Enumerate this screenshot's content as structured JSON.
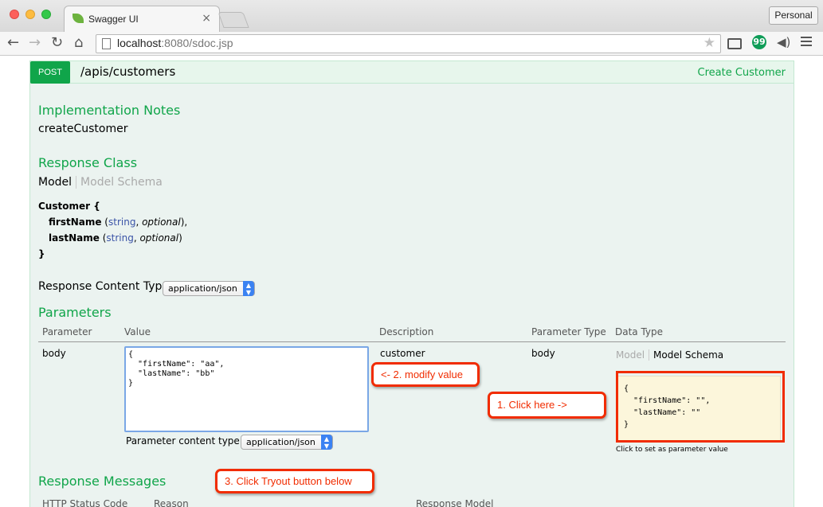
{
  "browser": {
    "tab_title": "Swagger UI",
    "tab_close": "×",
    "profile_label": "Personal",
    "url_host": "localhost",
    "url_rest": ":8080/sdoc.jsp",
    "icons": [
      "back-arrow-icon",
      "forward-arrow-icon",
      "reload-icon",
      "home-icon",
      "star-icon",
      "cast-icon",
      "hangouts-icon",
      "audio-icon",
      "menu-icon"
    ],
    "hangouts_glyph": "99"
  },
  "operation": {
    "method": "POST",
    "path": "/apis/customers",
    "summary": "Create Customer",
    "method_color": "#10a54a"
  },
  "implementation": {
    "heading": "Implementation Notes",
    "text": "createCustomer"
  },
  "response_class": {
    "heading": "Response Class",
    "tab_model": "Model",
    "tab_schema": "Model Schema",
    "model_name": "Customer {",
    "props": [
      {
        "name": "firstName",
        "type": "string",
        "opt": "optional",
        "end": "),"
      },
      {
        "name": "lastName",
        "type": "string",
        "opt": "optional",
        "end": ")"
      }
    ],
    "close": "}"
  },
  "response_content_type": {
    "label": "Response Content Type",
    "value": "application/json"
  },
  "parameters": {
    "heading": "Parameters",
    "columns": [
      "Parameter",
      "Value",
      "Description",
      "Parameter Type",
      "Data Type"
    ],
    "row": {
      "name": "body",
      "value": "{\n  \"firstName\": \"aa\",\n  \"lastName\": \"bb\"\n}",
      "description": "customer",
      "param_type": "body",
      "dt_tab_model": "Model",
      "dt_tab_schema": "Model Schema",
      "schema": "{\n  \"firstName\": \"\",\n  \"lastName\": \"\"\n}",
      "schema_hint": "Click to set as parameter value"
    },
    "content_type_label": "Parameter content type:",
    "content_type_value": "application/json"
  },
  "response_messages": {
    "heading": "Response Messages",
    "columns": [
      "HTTP Status Code",
      "Reason",
      "Response Model"
    ]
  },
  "callouts": {
    "modify": "<- 2. modify value",
    "click_here": "1. Click here ->",
    "tryout": "3. Click Tryout button below",
    "color": "#f12c00"
  }
}
